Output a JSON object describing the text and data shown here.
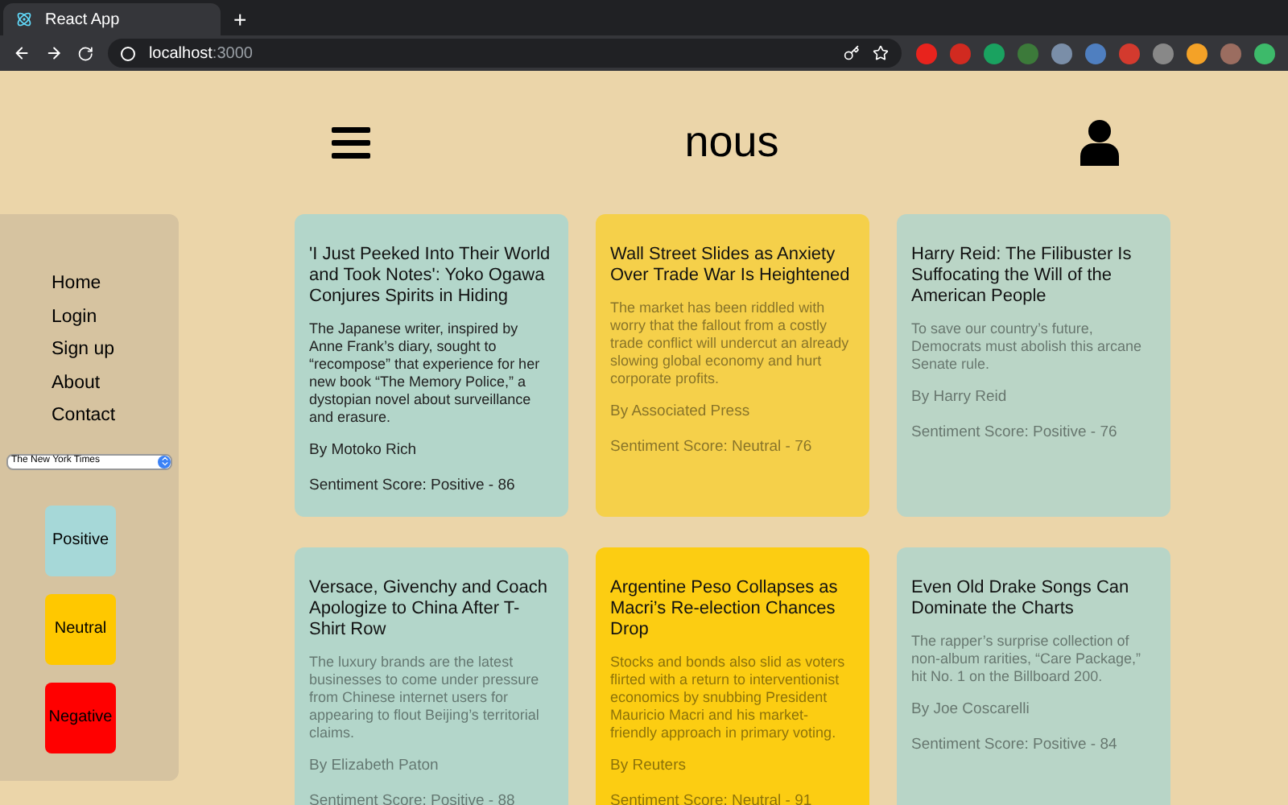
{
  "browser": {
    "tab_title": "React App",
    "new_tab": "+",
    "url_host": "localhost",
    "url_port": ":3000"
  },
  "header": {
    "logo": "nous"
  },
  "sidebar": {
    "links": [
      "Home",
      "Login",
      "Sign up",
      "About",
      "Contact"
    ],
    "source_select": "The New York Times",
    "sentiment_buttons": [
      {
        "label": "Positive",
        "color": "#a6d8d8"
      },
      {
        "label": "Neutral",
        "color": "#ffc800"
      },
      {
        "label": "Negative",
        "color": "#ff0000"
      }
    ]
  },
  "cards": [
    {
      "title": "'I Just Peeked Into Their World and Took Notes': Yoko Ogawa Conjures Spirits in Hiding",
      "summary": "The Japanese writer, inspired by Anne Frank’s diary, sought to “recompose” that experience for her new book “The Memory Police,” a dystopian novel about surveillance and erasure.",
      "byline": "By Motoko Rich",
      "score": "Sentiment Score: Positive - 86",
      "color": "#b3d6ca",
      "expanded": true
    },
    {
      "title": "Wall Street Slides as Anxiety Over Trade War Is Heightened",
      "summary": "The market has been riddled with worry that the fallout from a costly trade conflict will undercut an already slowing global economy and hurt corporate profits.",
      "byline": "By Associated Press",
      "score": "Sentiment Score: Neutral - 76",
      "color": "#f5d04a",
      "expanded": false
    },
    {
      "title": "Harry Reid: The Filibuster Is Suffocating the Will of the American People",
      "summary": "To save our country’s future, Democrats must abolish this arcane Senate rule.",
      "byline": "By Harry Reid",
      "score": "Sentiment Score: Positive - 76",
      "color": "#bad5c6",
      "expanded": false
    },
    {
      "title": "Versace, Givenchy and Coach Apologize to China After T-Shirt Row",
      "summary": "The luxury brands are the latest businesses to come under pressure from Chinese internet users for appearing to flout Beijing’s territorial claims.",
      "byline": "By Elizabeth Paton",
      "score": "Sentiment Score: Positive - 88",
      "color": "#b3d6ca",
      "expanded": false
    },
    {
      "title": "Argentine Peso Collapses as Macri’s Re-election Chances Drop",
      "summary": "Stocks and bonds also slid as voters flirted with a return to interventionist economics by snubbing President Mauricio Macri and his market-friendly approach in primary voting.",
      "byline": "By Reuters",
      "score": "Sentiment Score: Neutral - 91",
      "color": "#fccd12",
      "expanded": false
    },
    {
      "title": "Even Old Drake Songs Can Dominate the Charts",
      "summary": "The rapper’s surprise collection of non-album rarities, “Care Package,” hit No. 1 on the Billboard 200.",
      "byline": "By Joe Coscarelli",
      "score": "Sentiment Score: Positive - 84",
      "color": "#b8d5c7",
      "expanded": false
    }
  ]
}
